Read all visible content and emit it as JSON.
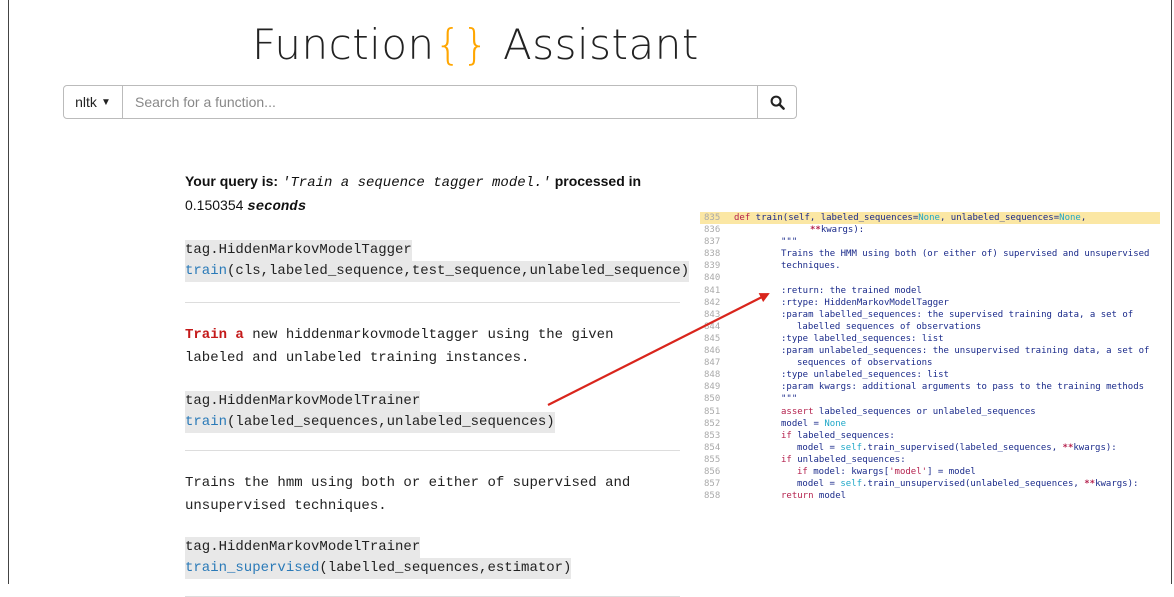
{
  "logo": {
    "part1": "Function",
    "brace": "{}",
    "part2": "Assistant"
  },
  "search": {
    "library": "nltk",
    "placeholder": "Search for a function..."
  },
  "query": {
    "prefix": "Your query is:",
    "text": "'Train a sequence tagger model.'",
    "middle": "processed in",
    "time": "0.150354",
    "unit": "seconds"
  },
  "results": [
    {
      "path": "tag.HiddenMarkovModelTagger",
      "fn": "train",
      "args": "(cls,labeled_sequence,test_sequence,unlabeled_sequence)"
    },
    {
      "desc_hl": "Train a",
      "desc_rest": " new hiddenmarkovmodeltagger using the given labeled and unlabeled training instances.",
      "path": "tag.HiddenMarkovModelTrainer",
      "fn": "train",
      "args": "(labeled_sequences,unlabeled_sequences)"
    },
    {
      "desc": "Trains the hmm using both or either of supervised and unsupervised techniques.",
      "path": "tag.HiddenMarkovModelTrainer",
      "fn": "train_supervised",
      "args": "(labelled_sequences,estimator)"
    }
  ],
  "code": {
    "line_numbers": [
      "835",
      "836",
      "837",
      "838",
      "839",
      "840",
      "841",
      "842",
      "843",
      "844",
      "845",
      "846",
      "847",
      "848",
      "849",
      "850",
      "851",
      "852",
      "853",
      "854",
      "855",
      "856",
      "857",
      "858"
    ],
    "def_kw": "def",
    "def_name": " train(self, labeled_sequences=",
    "none": "None",
    "def_mid": ", unlabeled_sequences=",
    "def_end": ",",
    "kwargs_op": "**",
    "kwargs_rest": "kwargs):",
    "doc_quote": "\"\"\"",
    "doc_1": "Trains the HMM using both (or either of) supervised and unsupervised",
    "doc_2": "techniques.",
    "doc_return": ":return: the trained model",
    "doc_rtype": ":rtype: HiddenMarkovModelTagger",
    "doc_p1": ":param labelled_sequences: the supervised training data, a set of",
    "doc_p1b": "labelled sequences of observations",
    "doc_t1": ":type labelled_sequences: list",
    "doc_p2": ":param unlabeled_sequences: the unsupervised training data, a set of",
    "doc_p2b": "sequences of observations",
    "doc_t2": ":type unlabeled_sequences: list",
    "doc_p3": ":param kwargs: additional arguments to pass to the training methods",
    "assert_kw": "assert",
    "assert_rest": " labeled_sequences or unlabeled_sequences",
    "model_none": "model = ",
    "if_kw": "if",
    "if1_rest": " labeled_sequences:",
    "ms1_a": "model = ",
    "self_kw": "self",
    "ms1_b": ".train_supervised(labeled_sequences, ",
    "if2_rest": " unlabeled_sequences:",
    "if3_rest": " model: kwargs[",
    "model_str": "'model'",
    "if3_end": "] = model",
    "ms2_b": ".train_unsupervised(unlabeled_sequences, ",
    "return_kw": "return",
    "return_rest": " model"
  },
  "colors": {
    "brace": "#ffa600",
    "arrow": "#d9251c",
    "highlight_line": "#fbe7a4",
    "link": "#2a7ab8"
  }
}
